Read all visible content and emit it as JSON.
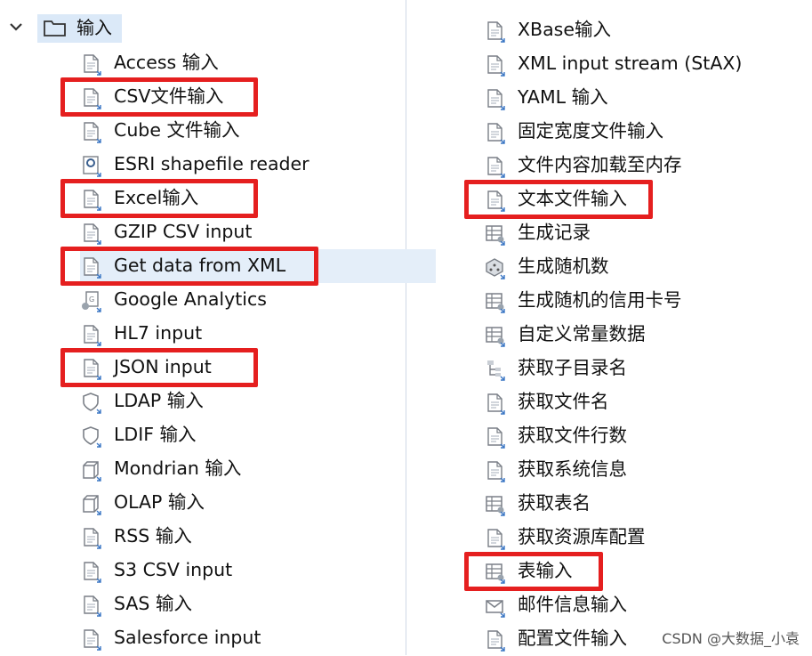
{
  "tree": {
    "folder_label": "输入",
    "left_items": [
      {
        "label": "Access 输入",
        "icon": "access-file-icon"
      },
      {
        "label": "CSV文件输入",
        "icon": "csv-file-icon"
      },
      {
        "label": "Cube 文件输入",
        "icon": "cube-file-icon"
      },
      {
        "label": "ESRI shapefile reader",
        "icon": "map-pin-icon"
      },
      {
        "label": "Excel输入",
        "icon": "excel-file-icon"
      },
      {
        "label": "GZIP CSV input",
        "icon": "gzip-file-icon"
      },
      {
        "label": "Get data from XML",
        "icon": "xml-file-icon"
      },
      {
        "label": "Google Analytics",
        "icon": "google-analytics-icon"
      },
      {
        "label": "HL7 input",
        "icon": "hl7-icon"
      },
      {
        "label": "JSON input",
        "icon": "json-file-icon"
      },
      {
        "label": "LDAP 输入",
        "icon": "shield-icon"
      },
      {
        "label": "LDIF 输入",
        "icon": "shield-icon"
      },
      {
        "label": "Mondrian 输入",
        "icon": "cube-icon"
      },
      {
        "label": "OLAP 输入",
        "icon": "cube-icon"
      },
      {
        "label": "RSS 输入",
        "icon": "rss-icon"
      },
      {
        "label": "S3 CSV input",
        "icon": "s3-file-icon"
      },
      {
        "label": "SAS 输入",
        "icon": "sas-file-icon"
      },
      {
        "label": "Salesforce input",
        "icon": "salesforce-icon"
      }
    ],
    "right_items": [
      {
        "label": "XBase输入",
        "icon": "dbf-file-icon"
      },
      {
        "label": "XML input stream (StAX)",
        "icon": "xml-stream-icon"
      },
      {
        "label": "YAML 输入",
        "icon": "yaml-file-icon"
      },
      {
        "label": "固定宽度文件输入",
        "icon": "fixed-width-file-icon"
      },
      {
        "label": "文件内容加载至内存",
        "icon": "file-load-icon"
      },
      {
        "label": "文本文件输入",
        "icon": "text-file-icon"
      },
      {
        "label": "生成记录",
        "icon": "generate-rows-icon"
      },
      {
        "label": "生成随机数",
        "icon": "random-dice-icon"
      },
      {
        "label": "生成随机的信用卡号",
        "icon": "credit-card-icon"
      },
      {
        "label": "自定义常量数据",
        "icon": "table-gear-icon"
      },
      {
        "label": "获取子目录名",
        "icon": "folder-tree-icon"
      },
      {
        "label": "获取文件名",
        "icon": "file-name-icon"
      },
      {
        "label": "获取文件行数",
        "icon": "line-count-icon"
      },
      {
        "label": "获取系统信息",
        "icon": "system-info-icon"
      },
      {
        "label": "获取表名",
        "icon": "table-name-icon"
      },
      {
        "label": "获取资源库配置",
        "icon": "repository-icon"
      },
      {
        "label": "表输入",
        "icon": "table-input-icon"
      },
      {
        "label": "邮件信息输入",
        "icon": "mail-icon"
      },
      {
        "label": "配置文件输入",
        "icon": "config-file-icon"
      }
    ]
  },
  "highlights": [
    "CSV文件输入",
    "Excel输入",
    "Get data from XML",
    "JSON input",
    "文本文件输入",
    "表输入"
  ],
  "colors": {
    "highlight_box": "#e51f1f",
    "selection": "#dbe9f8",
    "icon_gray": "#7a7f87",
    "icon_accent": "#3a76c4"
  },
  "watermark": "CSDN @大数据_小袁"
}
